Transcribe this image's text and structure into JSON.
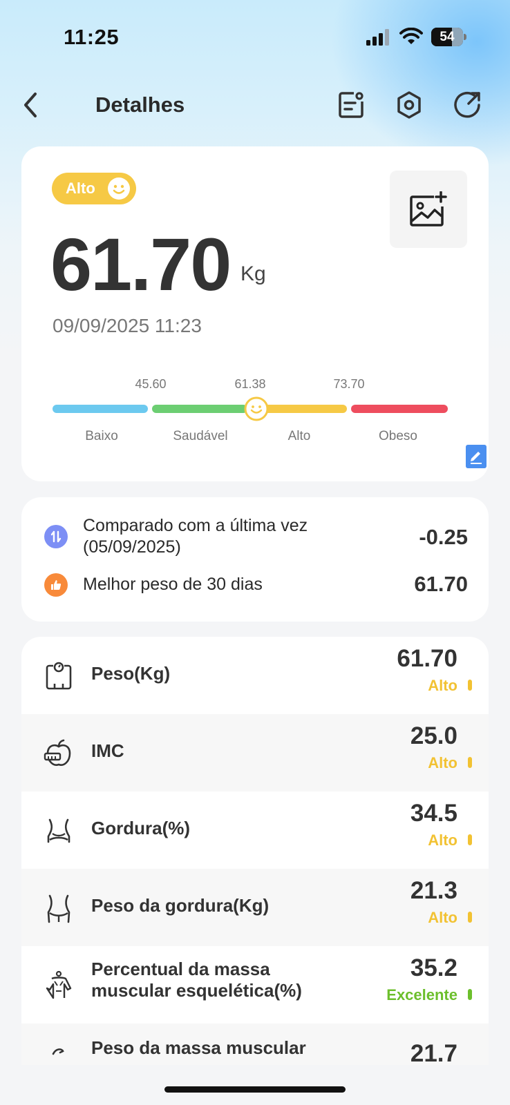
{
  "status_bar": {
    "time": "11:25",
    "battery": "54"
  },
  "header": {
    "title": "Detalhes"
  },
  "summary": {
    "status": "Alto",
    "weight": "61.70",
    "unit": "Kg",
    "datetime": "09/09/2025 11:23",
    "scale": {
      "ticks": [
        "45.60",
        "61.38",
        "73.70"
      ],
      "labels": [
        "Baixo",
        "Saudável",
        "Alto",
        "Obeso"
      ],
      "colors": {
        "low": "#6cc9ef",
        "healthy": "#6cce72",
        "high": "#f6c945",
        "obese": "#ee4d5e"
      }
    }
  },
  "compare": {
    "items": [
      {
        "label": "Comparado com a última vez",
        "sub": "(05/09/2025)",
        "value": "-0.25",
        "icon": "compare-arrows-icon",
        "color": "#7d8ff5"
      },
      {
        "label": "Melhor peso de 30 dias",
        "value": "61.70",
        "icon": "thumbs-up-icon",
        "color": "#f88a3a"
      }
    ]
  },
  "metrics": [
    {
      "name": "Peso(Kg)",
      "value": "61.70",
      "status": "Alto",
      "color": "#f2c233",
      "icon": "scale-icon"
    },
    {
      "name": "IMC",
      "value": "25.0",
      "status": "Alto",
      "color": "#f2c233",
      "icon": "apple-icon"
    },
    {
      "name": "Gordura(%)",
      "value": "34.5",
      "status": "Alto",
      "color": "#f2c233",
      "icon": "body-fat-icon"
    },
    {
      "name": "Peso da gordura(Kg)",
      "value": "21.3",
      "status": "Alto",
      "color": "#f2c233",
      "icon": "waist-icon"
    },
    {
      "name_line1": "Percentual da massa",
      "name_line2": "muscular esquelética(%)",
      "value": "35.2",
      "status": "Excelente",
      "color": "#6cbf2c",
      "icon": "muscle-body-icon"
    },
    {
      "name": "Peso da massa muscular",
      "value": "21.7",
      "icon": "arm-muscle-icon"
    }
  ]
}
